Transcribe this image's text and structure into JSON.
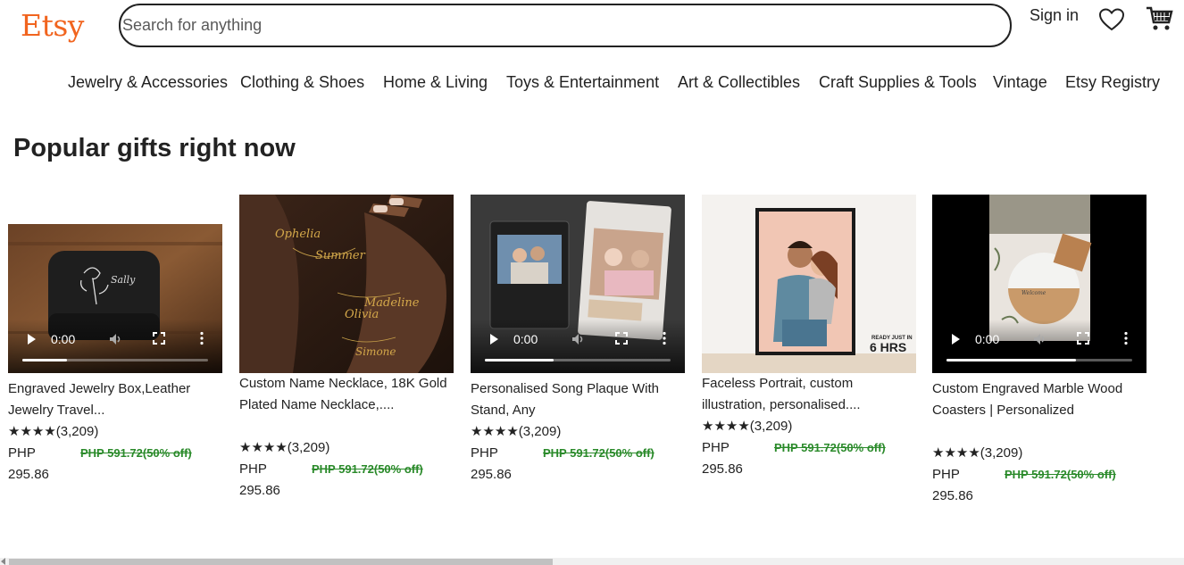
{
  "header": {
    "logo": "Etsy",
    "search_placeholder": "Search for anything",
    "signin_label": "Sign in",
    "favorites_icon": "heart-icon",
    "cart_icon": "cart-icon",
    "brand_color": "#f1641e"
  },
  "categories": [
    "Jewelry & Accessories",
    "Clothing & Shoes",
    "Home & Living",
    "Toys & Entertainment",
    "Art & Collectibles",
    "Craft Supplies & Tools",
    "Vintage",
    "Etsy Registry"
  ],
  "section_title": "Popular gifts right now",
  "products": [
    {
      "title": "Engraved Jewelry Box,Leather Jewelry Travel...",
      "stars": "★★★★",
      "reviews": "(3,209)",
      "price_currency": "PHP",
      "price": "295.86",
      "original": "PHP 591.72(50% off)",
      "video_time": "0:00",
      "progress": 0.24
    },
    {
      "title": "Custom Name Necklace, 18K Gold Plated Name Necklace,....",
      "stars": "★★★★",
      "reviews": "(3,209)",
      "price_currency": "PHP",
      "price": "295.86",
      "original": "PHP 591.72(50% off)"
    },
    {
      "title": "Personalised Song Plaque With Stand, Any",
      "stars": "★★★★",
      "reviews": "(3,209)",
      "price_currency": "PHP",
      "price": "295.86",
      "original": "PHP 591.72(50% off)",
      "video_time": "0:00",
      "progress": 0.37
    },
    {
      "title": "Faceless Portrait, custom illustration, personalised....",
      "stars": "★★★★",
      "reviews": "(3,209)",
      "price_currency": "PHP",
      "price": "295.86",
      "original": "PHP 591.72(50% off)",
      "badge_line1": "READY JUST IN",
      "badge_line2": "6 HRS"
    },
    {
      "title": "Custom Engraved Marble Wood Coasters | Personalized",
      "stars": "★★★★",
      "reviews": "(3,209)",
      "price_currency": "PHP",
      "price": "295.86",
      "original": "PHP 591.72(50% off)",
      "video_time": "0:00",
      "progress": 0.7
    }
  ]
}
